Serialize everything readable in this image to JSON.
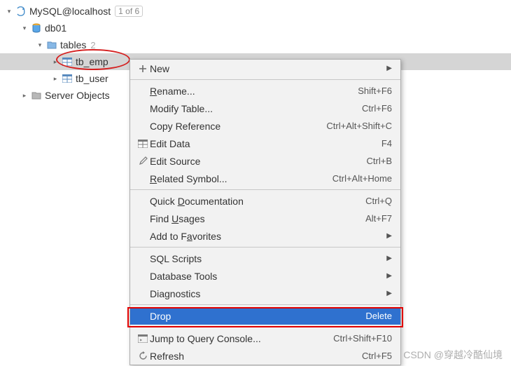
{
  "tree": {
    "root": {
      "label": "MySQL@localhost",
      "badge": "1 of 6"
    },
    "db": {
      "label": "db01"
    },
    "tables": {
      "label": "tables",
      "count": "2"
    },
    "tb_emp": {
      "label": "tb_emp"
    },
    "tb_user": {
      "label": "tb_user"
    },
    "server_objects": {
      "label": "Server Objects"
    }
  },
  "menu": {
    "new": {
      "label": "New"
    },
    "rename": {
      "label_pre": "",
      "u": "R",
      "label_post": "ename...",
      "shortcut": "Shift+F6"
    },
    "modify": {
      "label": "Modify Table...",
      "shortcut": "Ctrl+F6"
    },
    "copyref": {
      "label": "Copy Reference",
      "shortcut": "Ctrl+Alt+Shift+C"
    },
    "editdata": {
      "label": "Edit Data",
      "shortcut": "F4"
    },
    "editsrc": {
      "label": "Edit Source",
      "shortcut": "Ctrl+B"
    },
    "related": {
      "label_pre": "",
      "u": "R",
      "label_post": "elated Symbol...",
      "shortcut": "Ctrl+Alt+Home"
    },
    "quickdoc": {
      "label_pre": "Quick ",
      "u": "D",
      "label_post": "ocumentation",
      "shortcut": "Ctrl+Q"
    },
    "findusages": {
      "label_pre": "Find ",
      "u": "U",
      "label_post": "sages",
      "shortcut": "Alt+F7"
    },
    "favorites": {
      "label_pre": "Add to F",
      "u": "a",
      "label_post": "vorites"
    },
    "sqlscripts": {
      "label": "SQL Scripts"
    },
    "dbtools": {
      "label": "Database Tools"
    },
    "diagnostics": {
      "label": "Diagnostics"
    },
    "drop": {
      "label": "Drop",
      "shortcut": "Delete"
    },
    "jump": {
      "label": "Jump to Query Console...",
      "shortcut": "Ctrl+Shift+F10"
    },
    "refresh": {
      "label": "Refresh",
      "shortcut": "Ctrl+F5"
    }
  },
  "watermark": "CSDN @穿越冷酷仙境"
}
